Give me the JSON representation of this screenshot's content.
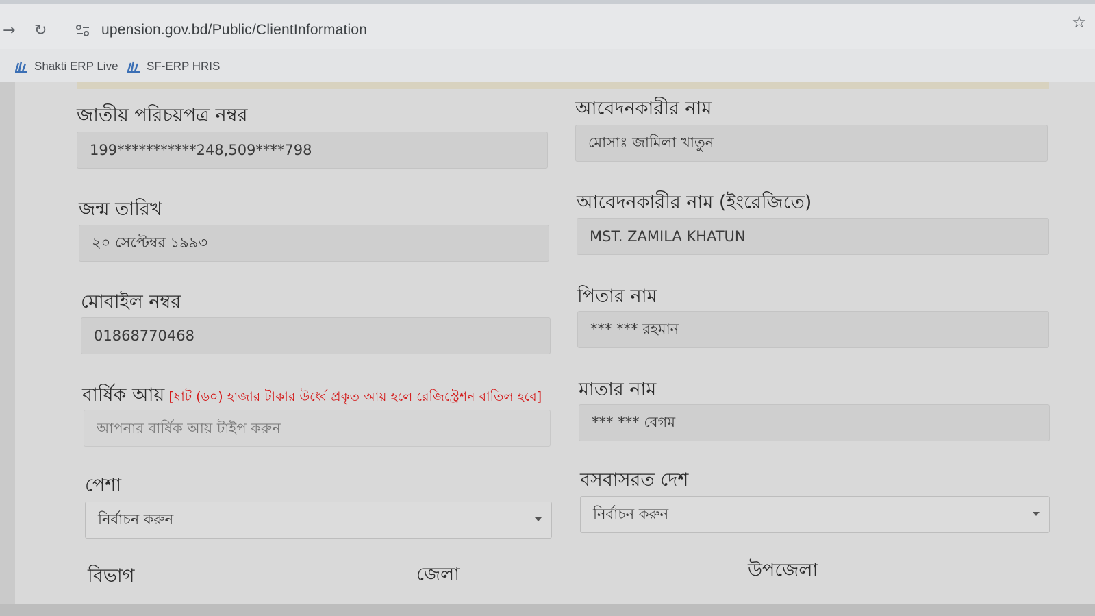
{
  "browser": {
    "url": "upension.gov.bd/Public/ClientInformation",
    "bookmarks": [
      {
        "label": "Shakti ERP Live",
        "icon": "shakti-logo-icon"
      },
      {
        "label": "SF-ERP HRIS",
        "icon": "shakti-logo-icon"
      }
    ]
  },
  "form": {
    "nid": {
      "label": "জাতীয় পরিচয়পত্র নম্বর",
      "value": "199***********248,509****798"
    },
    "applicant_name": {
      "label": "আবেদনকারীর নাম",
      "value": "মোসাঃ জামিলা খাতুন"
    },
    "dob": {
      "label": "জন্ম তারিখ",
      "value": "২০ সেপ্টেম্বর ১৯৯৩"
    },
    "applicant_name_en": {
      "label": "আবেদনকারীর নাম (ইংরেজিতে)",
      "value": "MST. ZAMILA KHATUN"
    },
    "mobile": {
      "label": "মোবাইল নম্বর",
      "value": "01868770468"
    },
    "father_name": {
      "label": "পিতার নাম",
      "value": "*** *** রহমান"
    },
    "annual_income": {
      "label": "বার্ষিক আয়",
      "note": "[ষাট (৬০) হাজার টাকার উর্ধ্বে প্রকৃত আয় হলে রেজিস্ট্রেশন বাতিল হবে]",
      "placeholder": "আপনার বার্ষিক আয় টাইপ করুন"
    },
    "mother_name": {
      "label": "মাতার নাম",
      "value": "*** *** বেগম"
    },
    "occupation": {
      "label": "পেশা",
      "selected": "নির্বাচন করুন"
    },
    "country": {
      "label": "বসবাসরত দেশ",
      "selected": "নির্বাচন করুন"
    },
    "division": {
      "label": "বিভাগ"
    },
    "district": {
      "label": "জেলা"
    },
    "upazila": {
      "label": "উপজেলা"
    }
  },
  "colors": {
    "note_red": "#d41a1a",
    "field_bg": "#cfcfcf"
  }
}
